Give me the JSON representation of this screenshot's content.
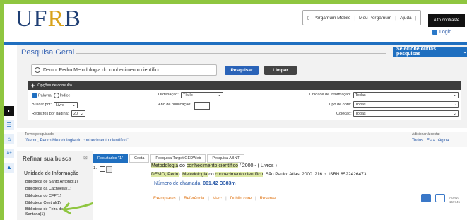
{
  "header": {
    "logo_left": "UF",
    "logo_accent": "R",
    "logo_right": "B",
    "nav": [
      "Pergamum Mobile",
      "Meu Pergamum",
      "Ajuda"
    ],
    "contrast": "Alto contraste",
    "login": "Login"
  },
  "sidebar_tabs": [
    "◐",
    "☰",
    "⌂",
    "A±",
    "▲"
  ],
  "search": {
    "title": "Pesquisa Geral",
    "select_other": "Selecione outras pesquisas",
    "query": "Demo, Pedro Metodologia do conhecimento científico",
    "search_btn": "Pesquisar",
    "clear_btn": "Limpar"
  },
  "options": {
    "header": "Opções de consulta",
    "radio_palavra": "Palavra",
    "radio_indice": "Índice",
    "buscar_por_label": "Buscar por:",
    "buscar_por_value": "Livre",
    "registros_label": "Registros por página:",
    "registros_value": "20",
    "ordenacao_label": "Ordenação:",
    "ordenacao_value": "Título",
    "ano_label": "Ano de publicação:",
    "unidade_label": "Unidade de Informação:",
    "unidade_value": "Todas",
    "tipo_label": "Tipo de obra:",
    "tipo_value": "Todas",
    "colecao_label": "Coleção:",
    "colecao_value": "Todas"
  },
  "term": {
    "label": "Termo pesquisado",
    "value": "\"Demo, Pedro Metodologia do conhecimento científico\"",
    "add_label": "Adicionar à cesta:",
    "all": "Todos",
    "this_page": "Esta página"
  },
  "refine": {
    "title": "Refinar sua busca",
    "unit_title": "Unidade de Informação",
    "libraries": [
      "Biblioteca de Santo Antônio(1)",
      "Biblioteca da Cachoeira(1)",
      "Biblioteca do CFP(1)",
      "Biblioteca Central(1)",
      "Biblioteca de Feira de",
      "Santana(1)"
    ]
  },
  "tabs": [
    "Resultados \"1\"",
    "Cesta",
    "Pesquisa Target GEDWeb",
    "Pesquisa ABNT"
  ],
  "result": {
    "number": "1.",
    "title_1": "Metodologia",
    "title_2": " do ",
    "title_3": "conhecimento científico",
    "title_4": " / 2000 - ( Livros )",
    "ref_1": "DEMO, ",
    "ref_2": "Pedro",
    "ref_3": ". ",
    "ref_4": "Metodologia",
    "ref_5": " do ",
    "ref_6": "conhecimento científico",
    "ref_7": ". São Paulo: Atlas, 2000. 216 p. ISBN 8522426473.",
    "call_label": "Número de chamada: ",
    "call_value": "001.42 D383m",
    "links": [
      "Exemplares",
      "Referência",
      "Marc",
      "Dublin core",
      "Reserva"
    ],
    "small": "Acervo 159745"
  },
  "colors": {
    "accent": "#1f6fc0",
    "frame": "#8fc640",
    "link_orange": "#e07a1e"
  }
}
